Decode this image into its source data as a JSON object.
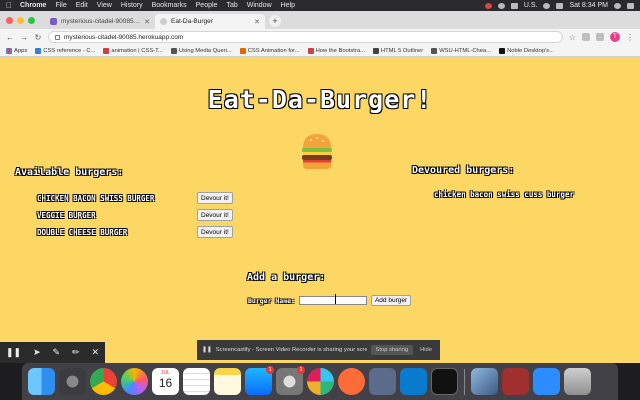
{
  "menubar": {
    "app_name": "Chrome",
    "items": [
      "File",
      "Edit",
      "View",
      "History",
      "Bookmarks",
      "People",
      "Tab",
      "Window",
      "Help"
    ],
    "input_source": "U.S.",
    "clock": "Sat 8:34 PM"
  },
  "tabs": [
    {
      "title": "mysterious-citadel-90085 · 8e",
      "active": false
    },
    {
      "title": "Eat-Da-Burger",
      "active": true
    }
  ],
  "address_bar": {
    "url": "mysterious-citadel-90085.herokuapp.com"
  },
  "profile": {
    "initial": "T"
  },
  "bookmarks": [
    {
      "label": "Apps",
      "icon": "apps-grid-icon"
    },
    {
      "label": "CSS reference - C...",
      "icon": "css-reference-icon"
    },
    {
      "label": "animation | CSS-T...",
      "icon": "css-tricks-icon"
    },
    {
      "label": "Using Media Queri...",
      "icon": "mdn-icon"
    },
    {
      "label": "CSS Animation for...",
      "icon": "animation-icon"
    },
    {
      "label": "How the Bootstra...",
      "icon": "bootstrap-icon"
    },
    {
      "label": "HTML 5 Outliner",
      "icon": "html5-icon"
    },
    {
      "label": "WSU-HTML-Chea...",
      "icon": "wsu-icon"
    },
    {
      "label": "Noble Desktop's...",
      "icon": "noble-icon"
    }
  ],
  "page": {
    "title": "Eat-Da-Burger!",
    "available_heading": "Available burgers:",
    "devoured_heading": "Devoured burgers:",
    "available_burgers": [
      {
        "name": "CHICKEN BACON SWISS BURGER",
        "button": "Devour it!"
      },
      {
        "name": "VEGGIE BURGER",
        "button": "Devour it!"
      },
      {
        "name": "DOUBLE CHEESE BURGER",
        "button": "Devour it!"
      }
    ],
    "devoured_burgers": [
      "chicken bacon swiss cuss burger"
    ],
    "add_heading": "Add a burger:",
    "form_label": "Burger Name:",
    "input_value": "",
    "add_button": "Add burger"
  },
  "screencastify": {
    "message": "Screencastify - Screen Video Recorder is sharing your screen.",
    "stop_label": "Stop sharing",
    "hide_label": "Hide"
  },
  "dock": {
    "calendar": {
      "month": "JUL",
      "day": "16"
    },
    "badges": {
      "app_store": "1",
      "system_prefs": "1"
    },
    "apps": [
      "finder-icon",
      "launchpad-icon",
      "chrome-icon",
      "photos-icon",
      "calendar-icon",
      "reminders-icon",
      "notes-icon",
      "app-store-icon",
      "system-preferences-icon",
      "slack-icon",
      "postman-icon",
      "git-icon",
      "vscode-icon",
      "terminal-icon",
      "preview-icon",
      "dictionary-icon",
      "zoom-icon",
      "trash-icon"
    ]
  },
  "colors": {
    "page_background": "#fdd764",
    "dock_background": "#46464b"
  }
}
